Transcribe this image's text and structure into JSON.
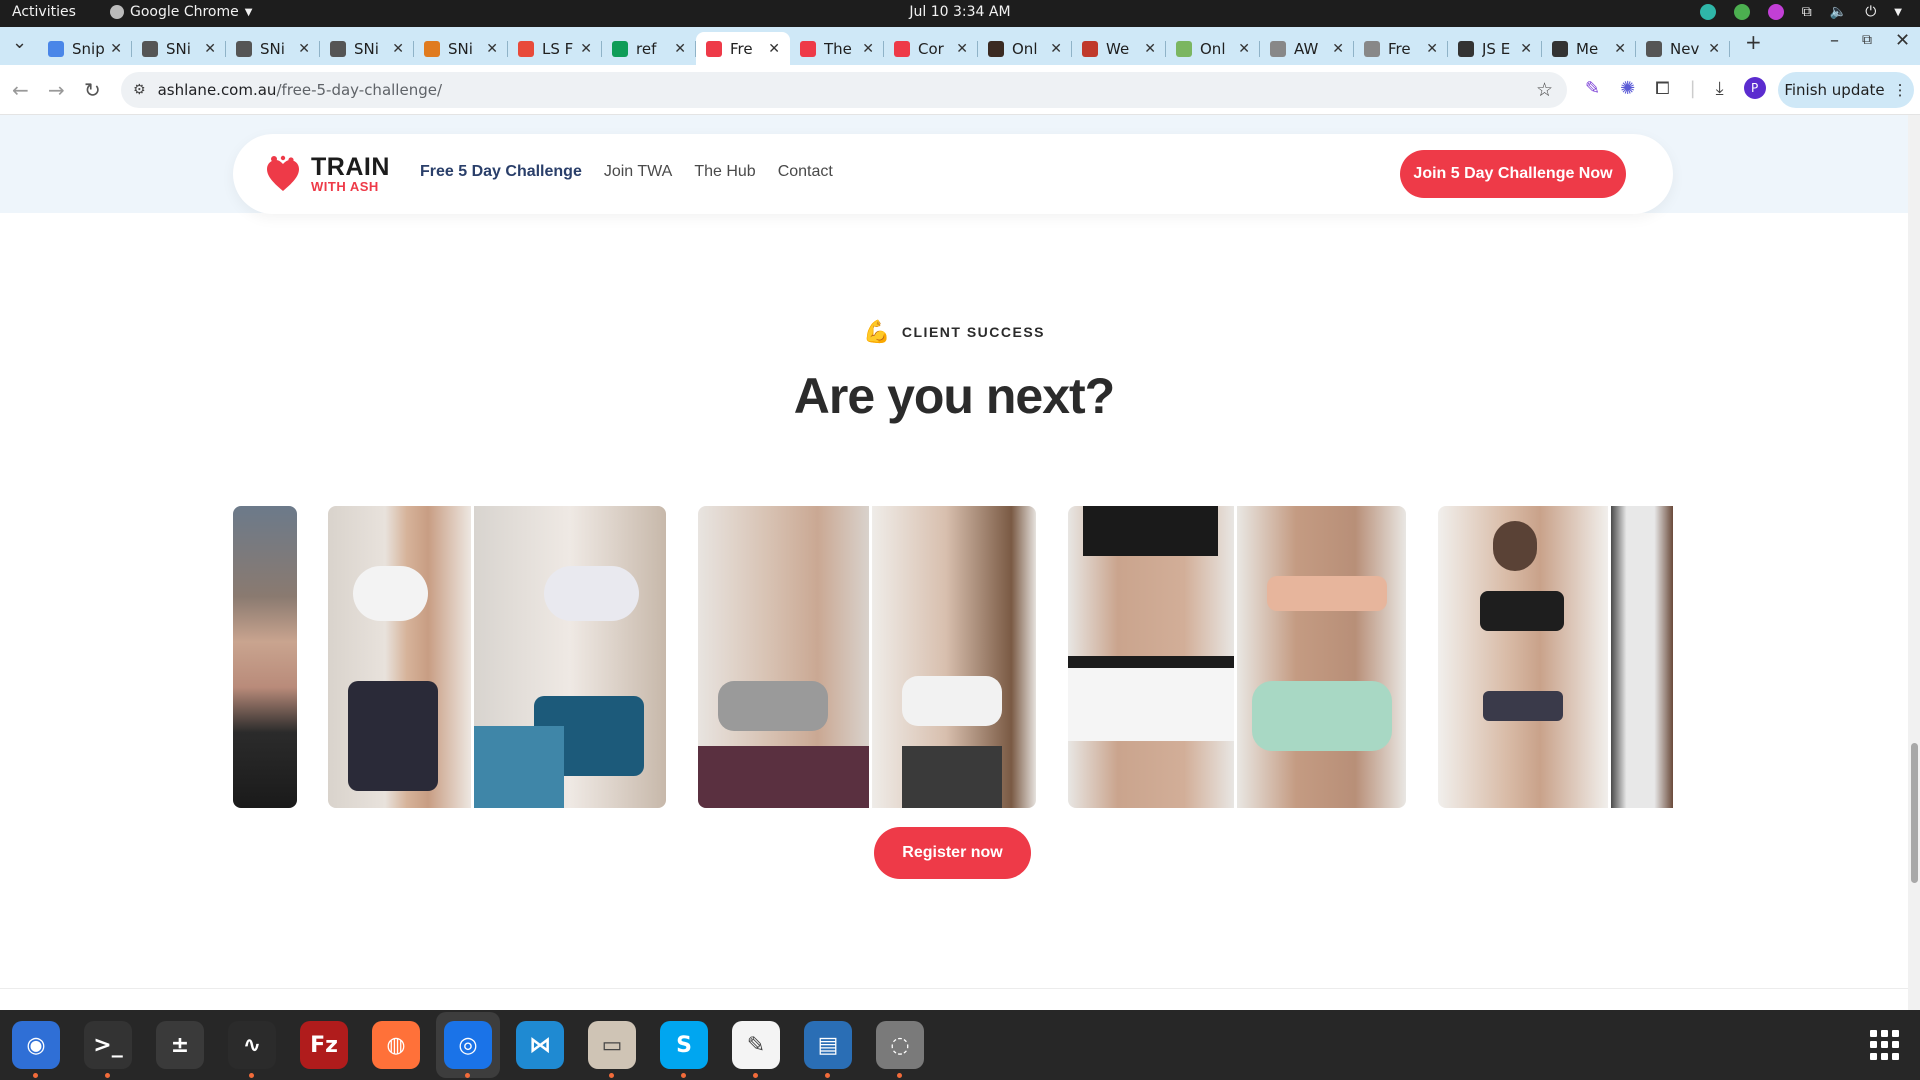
{
  "system_bar": {
    "activities": "Activities",
    "app_name": "Google Chrome",
    "clock": "Jul 10  3:34 AM"
  },
  "tabs": [
    {
      "label": "Snip",
      "icon": "docs-icon",
      "color": "#4a86e8"
    },
    {
      "label": "SNi",
      "icon": "snp-icon",
      "color": "#555555"
    },
    {
      "label": "SNi",
      "icon": "snp-icon",
      "color": "#555555"
    },
    {
      "label": "SNi",
      "icon": "snp-icon",
      "color": "#555555"
    },
    {
      "label": "SNi",
      "icon": "burger-icon",
      "color": "#e07b1f"
    },
    {
      "label": "LS F",
      "icon": "ls-icon",
      "color": "#e84a3a"
    },
    {
      "label": "ref",
      "icon": "sheets-icon",
      "color": "#0f9d58"
    },
    {
      "label": "Fre",
      "icon": "heart-icon",
      "color": "#ee3a48",
      "active": true
    },
    {
      "label": "The",
      "icon": "heart-icon",
      "color": "#ee3a48"
    },
    {
      "label": "Cor",
      "icon": "heart-icon",
      "color": "#ee3a48"
    },
    {
      "label": "Onl",
      "icon": "person-icon",
      "color": "#3a2a22"
    },
    {
      "label": "We",
      "icon": "person-icon",
      "color": "#c0392b"
    },
    {
      "label": "Onl",
      "icon": "image-icon",
      "color": "#7bb661"
    },
    {
      "label": "AW",
      "icon": "photo-icon",
      "color": "#888888"
    },
    {
      "label": "Fre",
      "icon": "photo-icon",
      "color": "#888888"
    },
    {
      "label": "JS E",
      "icon": "shield-icon",
      "color": "#333333"
    },
    {
      "label": "Me",
      "icon": "shield-icon",
      "color": "#333333"
    },
    {
      "label": "Nev",
      "icon": "chrome-icon",
      "color": "#555555"
    }
  ],
  "address_bar": {
    "host": "ashlane.com.au",
    "path": "/free-5-day-challenge/"
  },
  "toolbar": {
    "profile_initial": "P",
    "finish_update": "Finish update"
  },
  "site": {
    "logo_line1": "TRAIN",
    "logo_line2": "WITH ASH",
    "nav": [
      "Free 5 Day Challenge",
      "Join TWA",
      "The Hub",
      "Contact"
    ],
    "cta": "Join 5 Day Challenge Now",
    "brand_color": "#ee3a48"
  },
  "section": {
    "eyebrow": "CLIENT SUCCESS",
    "heading": "Are you next?",
    "register": "Register now"
  },
  "dock": [
    {
      "name": "thunderbird-icon",
      "color": "#2f6fd6"
    },
    {
      "name": "terminal-icon",
      "color": "#333333"
    },
    {
      "name": "calculator-icon",
      "color": "#3a3a3a"
    },
    {
      "name": "system-monitor-icon",
      "color": "#2b2b2b"
    },
    {
      "name": "filezilla-icon",
      "color": "#b01c1c"
    },
    {
      "name": "firefox-icon",
      "color": "#ff7139"
    },
    {
      "name": "chrome-icon",
      "color": "#1a73e8"
    },
    {
      "name": "vscode-icon",
      "color": "#1f8ad2"
    },
    {
      "name": "files-icon",
      "color": "#cfc4b5"
    },
    {
      "name": "skype-icon",
      "color": "#00a6f0"
    },
    {
      "name": "text-editor-icon",
      "color": "#f4f4f4"
    },
    {
      "name": "writer-icon",
      "color": "#2a6eb5"
    },
    {
      "name": "disk-icon",
      "color": "#7a7a7a"
    }
  ]
}
